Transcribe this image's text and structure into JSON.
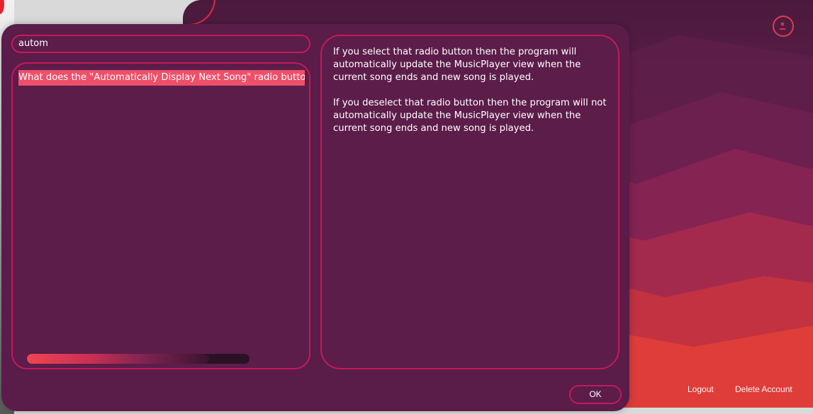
{
  "search": {
    "value": "autom"
  },
  "results": [
    {
      "label": "What does the \"Automatically Display Next Song\" radio button in"
    }
  ],
  "answer": {
    "paragraphs": [
      "If you select that radio button then the program will automatically update the MusicPlayer view when the current song ends and new song is played.",
      "If you deselect that radio button then the program will not automatically update the MusicPlayer view when the current song ends and new song is played."
    ]
  },
  "scroll": {
    "visible_fraction": 0.82
  },
  "dialog": {
    "ok_label": "OK"
  },
  "background_window": {
    "logout_label": "Logout",
    "delete_account_label": "Delete Account"
  },
  "colors": {
    "accent": "#c4195c",
    "panel": "#5c1d4a",
    "highlight": "#ee4f69"
  },
  "icons": {
    "close": "close-icon"
  }
}
